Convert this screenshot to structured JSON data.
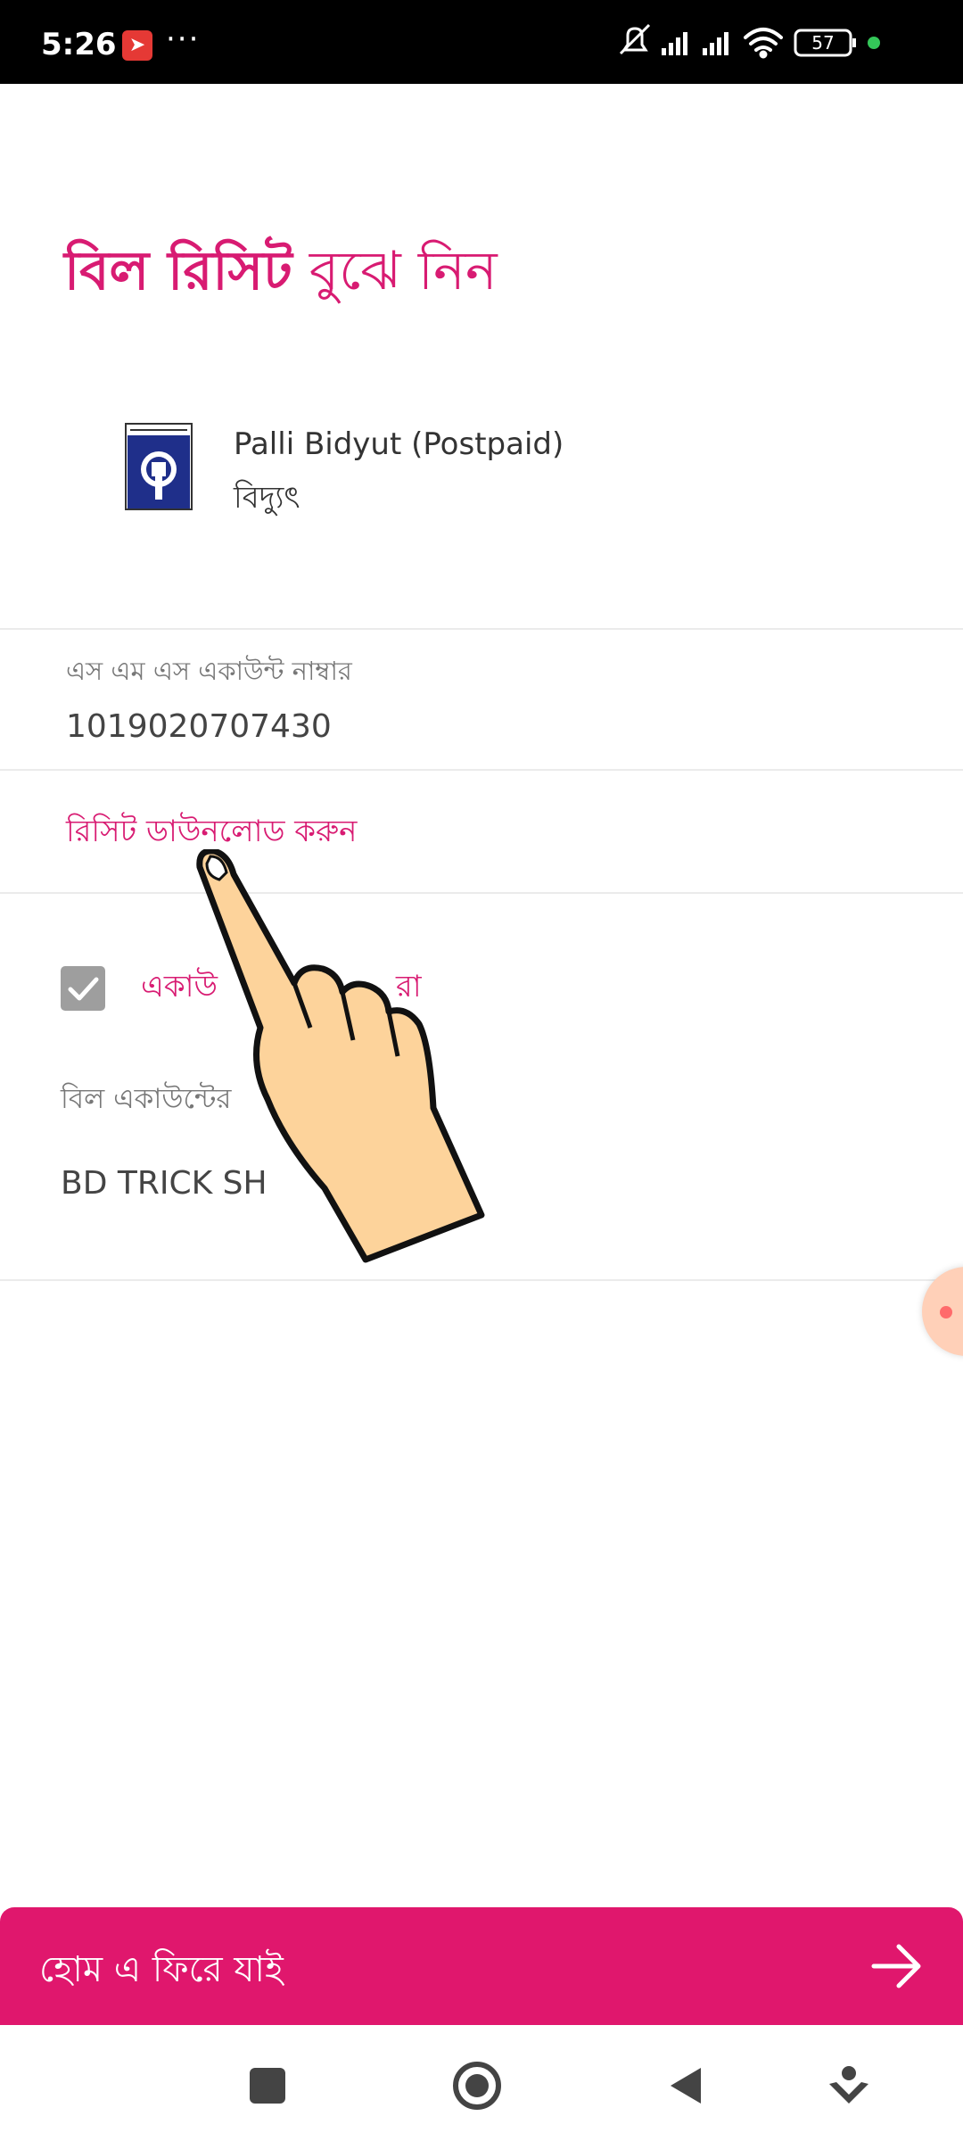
{
  "status_bar": {
    "time": "5:26",
    "dots": "···",
    "battery": "57"
  },
  "header": {
    "title_bold": "বিল রিসিট",
    "title_regular": " বুঝে নিন"
  },
  "biller": {
    "name": "Palli Bidyut (Postpaid)",
    "category": "বিদ্যুৎ",
    "logo_icon": "palli-bidyut-logo"
  },
  "account": {
    "label": "এস এম এস একাউন্ট নাম্বার",
    "value": "1019020707430"
  },
  "receipt": {
    "download_label": "রিসিট ডাউনলোড করুন"
  },
  "save_account": {
    "checked": true,
    "label_start": "একাউ",
    "label_end": "রা"
  },
  "bill_account_name": {
    "label": "বিল একাউন্টের",
    "value": "BD TRICK SH"
  },
  "footer": {
    "home_button_label": "হোম এ ফিরে যাই"
  },
  "colors": {
    "accent": "#d81b72",
    "button_bg": "#e0176d"
  }
}
